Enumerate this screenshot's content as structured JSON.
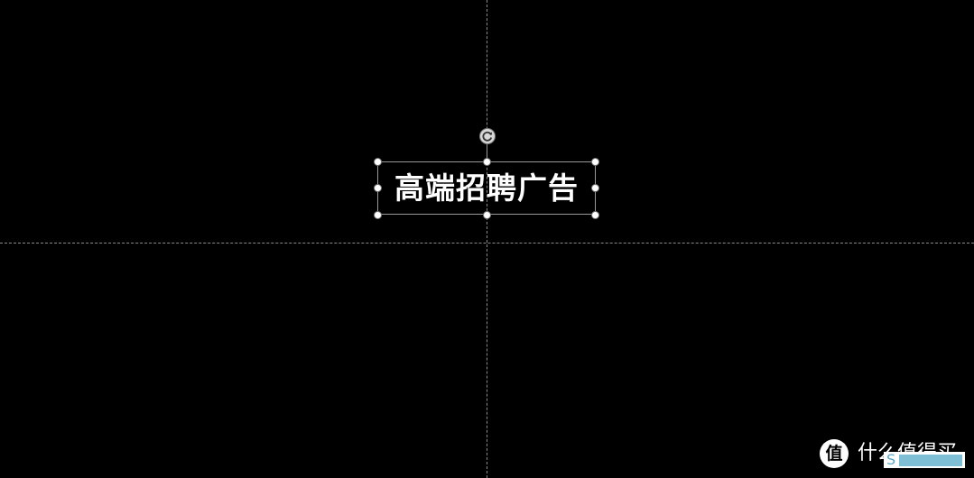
{
  "slide": {
    "textbox_text": "高端招聘广告"
  },
  "watermark": {
    "logo_char": "值",
    "text": "什么值得买",
    "overlay_letter": "S"
  },
  "colors": {
    "background": "#000000",
    "text": "#ffffff",
    "guide": "#8a8a8a",
    "selection_border": "#9a9a9a",
    "overlay_accent": "#7fbfd6"
  },
  "icons": {
    "rotate": "rotate-icon",
    "resize_handle": "resize-handle"
  }
}
